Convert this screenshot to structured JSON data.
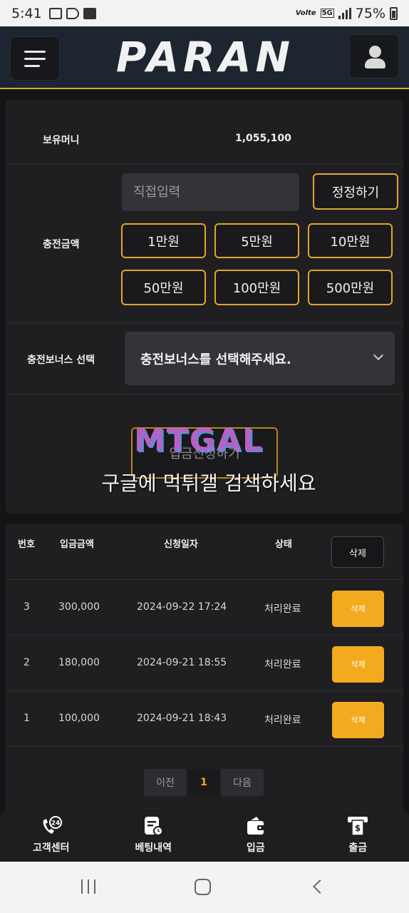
{
  "status_bar": {
    "time": "5:41",
    "network": "5G",
    "carrier": "Volte",
    "battery": "75%"
  },
  "header": {
    "logo": "PARAN",
    "menu_icon": "hamburger-icon",
    "user_icon": "user-icon"
  },
  "charge": {
    "balance_label": "보유머니",
    "balance_value": "1,055,100",
    "amount_label": "충전금액",
    "input_placeholder": "직접입력",
    "reset_button": "정정하기",
    "quick_amounts": [
      "1만원",
      "5만원",
      "10만원",
      "50만원",
      "100만원",
      "500만원"
    ],
    "bonus_label": "충전보너스 선택",
    "bonus_select": "충전보너스를 선택해주세요.",
    "submit_button": "입금신청하기",
    "watermark_logo": "MTGAL",
    "watermark_text": "구글에 먹튀갤 검색하세요"
  },
  "history": {
    "headers": {
      "no": "번호",
      "amount": "입금금액",
      "date": "신청일자",
      "status": "상태",
      "delete": "삭제"
    },
    "rows": [
      {
        "no": "3",
        "amount": "300,000",
        "date": "2024-09-22 17:24",
        "status": "처리완료",
        "delete": "삭제"
      },
      {
        "no": "2",
        "amount": "180,000",
        "date": "2024-09-21 18:55",
        "status": "처리완료",
        "delete": "삭제"
      },
      {
        "no": "1",
        "amount": "100,000",
        "date": "2024-09-21 18:43",
        "status": "처리완료",
        "delete": "삭제"
      }
    ]
  },
  "pagination": {
    "prev": "이전",
    "current": "1",
    "next": "다음"
  },
  "bottom_nav": [
    {
      "label": "고객센터",
      "icon": "support-24-icon"
    },
    {
      "label": "베팅내역",
      "icon": "betting-history-icon"
    },
    {
      "label": "입금",
      "icon": "wallet-icon"
    },
    {
      "label": "출금",
      "icon": "atm-withdraw-icon"
    }
  ],
  "colors": {
    "accent": "#e0a62a",
    "delete_button": "#f4aa1f",
    "panel": "#1f1f22",
    "background": "#141416"
  }
}
